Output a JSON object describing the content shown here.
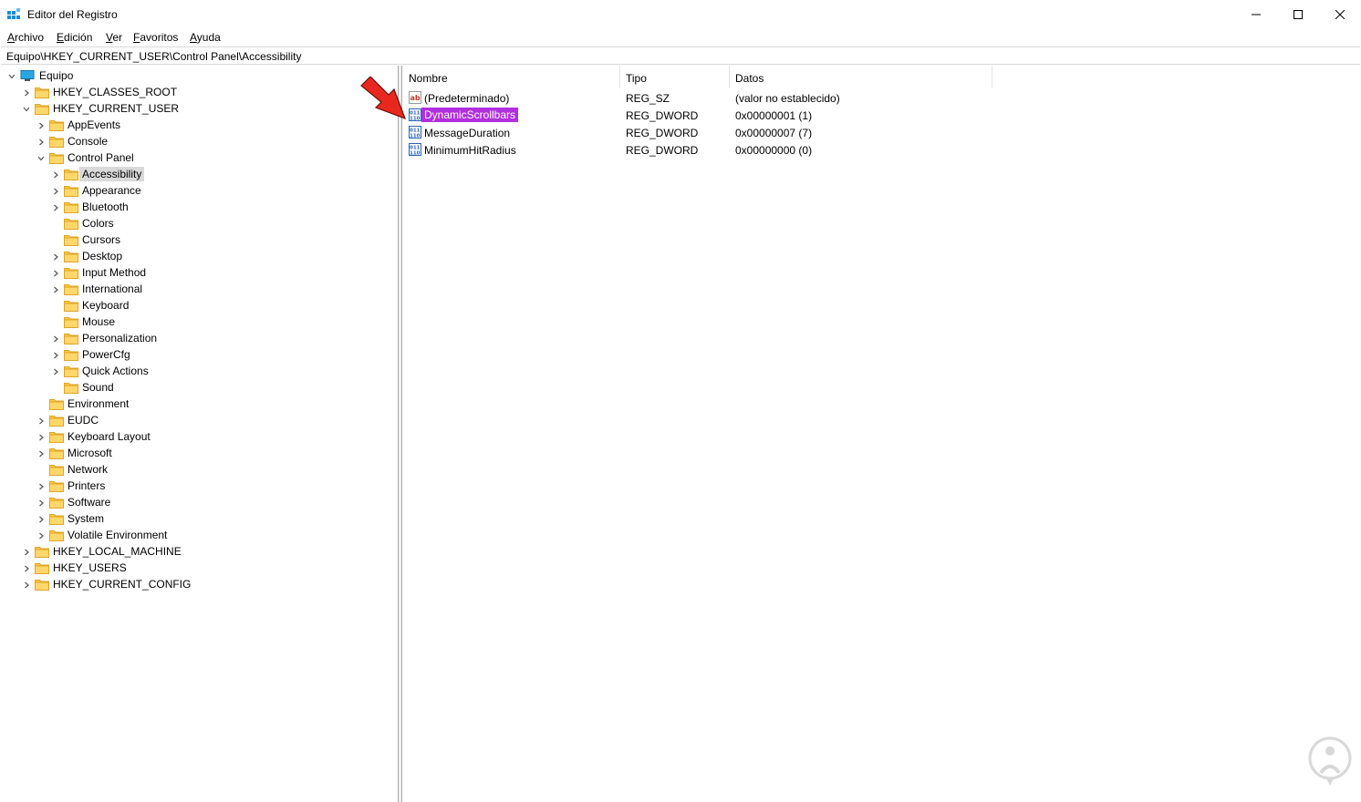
{
  "window": {
    "title": "Editor del Registro",
    "minimize_glyph": "—",
    "maximize_glyph": "□",
    "close_glyph": "✕"
  },
  "menu": {
    "items": [
      {
        "accel": "A",
        "rest": "rchivo"
      },
      {
        "accel": "E",
        "rest": "dición"
      },
      {
        "accel": "V",
        "rest": "er"
      },
      {
        "accel": "F",
        "rest": "avoritos"
      },
      {
        "accel": "A",
        "rest": "yuda"
      }
    ]
  },
  "address": {
    "path": "Equipo\\HKEY_CURRENT_USER\\Control Panel\\Accessibility"
  },
  "tree": {
    "root": "Equipo",
    "nodes": [
      {
        "label": "HKEY_CLASSES_ROOT",
        "chevron": "right"
      },
      {
        "label": "HKEY_CURRENT_USER",
        "chevron": "down"
      },
      {
        "label": "AppEvents",
        "chevron": "right"
      },
      {
        "label": "Console",
        "chevron": "right"
      },
      {
        "label": "Control Panel",
        "chevron": "down"
      },
      {
        "label": "Accessibility",
        "chevron": "right",
        "selected": true
      },
      {
        "label": "Appearance",
        "chevron": "right"
      },
      {
        "label": "Bluetooth",
        "chevron": "right"
      },
      {
        "label": "Colors",
        "chevron": "none"
      },
      {
        "label": "Cursors",
        "chevron": "none"
      },
      {
        "label": "Desktop",
        "chevron": "right"
      },
      {
        "label": "Input Method",
        "chevron": "right"
      },
      {
        "label": "International",
        "chevron": "right"
      },
      {
        "label": "Keyboard",
        "chevron": "none"
      },
      {
        "label": "Mouse",
        "chevron": "none"
      },
      {
        "label": "Personalization",
        "chevron": "right"
      },
      {
        "label": "PowerCfg",
        "chevron": "right"
      },
      {
        "label": "Quick Actions",
        "chevron": "right"
      },
      {
        "label": "Sound",
        "chevron": "none"
      },
      {
        "label": "Environment",
        "chevron": "none"
      },
      {
        "label": "EUDC",
        "chevron": "right"
      },
      {
        "label": "Keyboard Layout",
        "chevron": "right"
      },
      {
        "label": "Microsoft",
        "chevron": "right"
      },
      {
        "label": "Network",
        "chevron": "none"
      },
      {
        "label": "Printers",
        "chevron": "right"
      },
      {
        "label": "Software",
        "chevron": "right"
      },
      {
        "label": "System",
        "chevron": "right"
      },
      {
        "label": "Volatile Environment",
        "chevron": "right"
      },
      {
        "label": "HKEY_LOCAL_MACHINE",
        "chevron": "right"
      },
      {
        "label": "HKEY_USERS",
        "chevron": "right"
      },
      {
        "label": "HKEY_CURRENT_CONFIG",
        "chevron": "right"
      }
    ]
  },
  "values_list": {
    "columns": [
      "Nombre",
      "Tipo",
      "Datos"
    ],
    "rows": [
      {
        "name": "(Predeterminado)",
        "type": "REG_SZ",
        "data": "(valor no establecido)",
        "icon": "string-value-icon"
      },
      {
        "name": "DynamicScrollbars",
        "type": "REG_DWORD",
        "data": "0x00000001 (1)",
        "icon": "dword-value-icon",
        "selected": true
      },
      {
        "name": "MessageDuration",
        "type": "REG_DWORD",
        "data": "0x00000007 (7)",
        "icon": "dword-value-icon"
      },
      {
        "name": "MinimumHitRadius",
        "type": "REG_DWORD",
        "data": "0x00000000 (0)",
        "icon": "dword-value-icon"
      }
    ]
  },
  "colors": {
    "selection_purple": "#b12fde",
    "tree_selected_bg": "#d9d9d9",
    "folder_yellow": "#ffc83d",
    "arrow_red": "#e8281e"
  }
}
